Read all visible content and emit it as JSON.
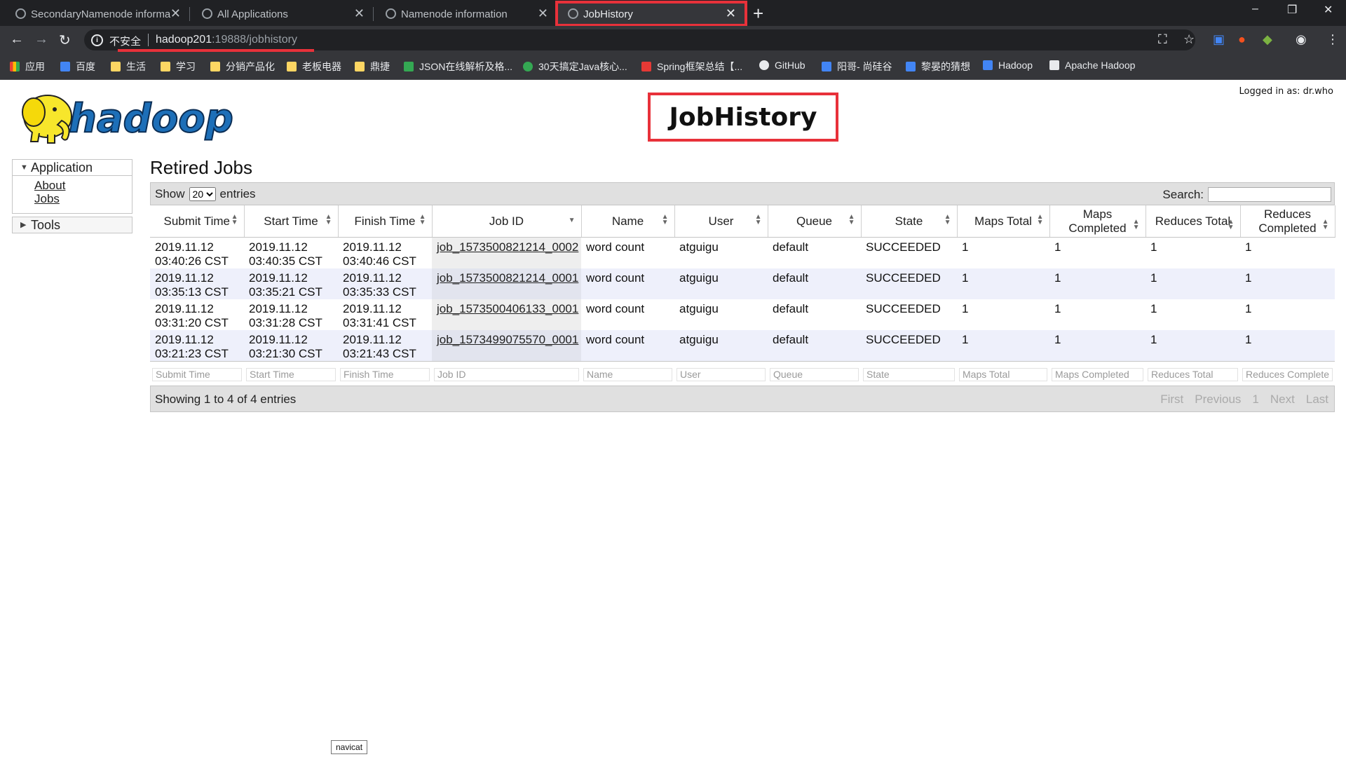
{
  "browser": {
    "tabs": [
      {
        "title": "SecondaryNamenode informa",
        "active": false
      },
      {
        "title": "All Applications",
        "active": false
      },
      {
        "title": "Namenode information",
        "active": false
      },
      {
        "title": "JobHistory",
        "active": true
      }
    ],
    "new_tab": "+",
    "controls": {
      "minimize": "–",
      "restore": "❐",
      "close": "✕"
    },
    "insecure_label": "不安全",
    "url_host": "hadoop201",
    "url_rest": ":19888/jobhistory",
    "bookmarks": [
      {
        "label": "应用",
        "icon": "apps-grid-icon"
      },
      {
        "label": "百度",
        "icon": "baidu-icon"
      },
      {
        "label": "生活",
        "icon": "folder-icon"
      },
      {
        "label": "学习",
        "icon": "folder-icon"
      },
      {
        "label": "分销产品化",
        "icon": "folder-icon"
      },
      {
        "label": "老板电器",
        "icon": "folder-icon"
      },
      {
        "label": "鼎捷",
        "icon": "folder-icon"
      },
      {
        "label": "JSON在线解析及格...",
        "icon": "json-icon"
      },
      {
        "label": "30天搞定Java核心...",
        "icon": "g-icon"
      },
      {
        "label": "Spring框架总结【...",
        "icon": "csdn-icon"
      },
      {
        "label": "GitHub",
        "icon": "github-icon"
      },
      {
        "label": "阳哥- 尚硅谷",
        "icon": "bilibili-icon"
      },
      {
        "label": "黎晏的猜想",
        "icon": "bilibili-icon"
      },
      {
        "label": "Hadoop",
        "icon": "bilibili-icon"
      },
      {
        "label": "Apache Hadoop",
        "icon": "apache-icon"
      }
    ]
  },
  "page": {
    "logo_text": "hadoop",
    "logged_in": "Logged in as: dr.who",
    "title": "JobHistory",
    "sidebar": {
      "application": "Application",
      "links": [
        "About",
        "Jobs"
      ],
      "tools": "Tools"
    },
    "section_title": "Retired Jobs",
    "table_controls": {
      "show": "Show",
      "entries_value": "20",
      "entries": "entries",
      "search": "Search:"
    },
    "columns": [
      "Submit Time",
      "Start Time",
      "Finish Time",
      "Job ID",
      "Name",
      "User",
      "Queue",
      "State",
      "Maps Total",
      "Maps Completed",
      "Reduces Total",
      "Reduces Completed"
    ],
    "rows": [
      {
        "submit": "2019.11.12 03:40:26 CST",
        "start": "2019.11.12 03:40:35 CST",
        "finish": "2019.11.12 03:40:46 CST",
        "job_id": "job_1573500821214_0002",
        "name": "word count",
        "user": "atguigu",
        "queue": "default",
        "state": "SUCCEEDED",
        "maps_total": "1",
        "maps_completed": "1",
        "reduces_total": "1",
        "reduces_completed": "1"
      },
      {
        "submit": "2019.11.12 03:35:13 CST",
        "start": "2019.11.12 03:35:21 CST",
        "finish": "2019.11.12 03:35:33 CST",
        "job_id": "job_1573500821214_0001",
        "name": "word count",
        "user": "atguigu",
        "queue": "default",
        "state": "SUCCEEDED",
        "maps_total": "1",
        "maps_completed": "1",
        "reduces_total": "1",
        "reduces_completed": "1"
      },
      {
        "submit": "2019.11.12 03:31:20 CST",
        "start": "2019.11.12 03:31:28 CST",
        "finish": "2019.11.12 03:31:41 CST",
        "job_id": "job_1573500406133_0001",
        "name": "word count",
        "user": "atguigu",
        "queue": "default",
        "state": "SUCCEEDED",
        "maps_total": "1",
        "maps_completed": "1",
        "reduces_total": "1",
        "reduces_completed": "1"
      },
      {
        "submit": "2019.11.12 03:21:23 CST",
        "start": "2019.11.12 03:21:30 CST",
        "finish": "2019.11.12 03:21:43 CST",
        "job_id": "job_1573499075570_0001",
        "name": "word count",
        "user": "atguigu",
        "queue": "default",
        "state": "SUCCEEDED",
        "maps_total": "1",
        "maps_completed": "1",
        "reduces_total": "1",
        "reduces_completed": "1"
      }
    ],
    "filters": [
      "Submit Time",
      "Start Time",
      "Finish Time",
      "Job ID",
      "Name",
      "User",
      "Queue",
      "State",
      "Maps Total",
      "Maps Completed",
      "Reduces Total",
      "Reduces Complete"
    ],
    "footer": {
      "info": "Showing 1 to 4 of 4 entries",
      "pager": [
        "First",
        "Previous",
        "1",
        "Next",
        "Last"
      ]
    }
  },
  "tooltip": "navicat",
  "colors": {
    "highlight": "#e8313a",
    "chrome_dark": "#202124",
    "chrome": "#35363a",
    "logo_yellow": "#f7e62b",
    "logo_blue": "#1d6fb8"
  }
}
